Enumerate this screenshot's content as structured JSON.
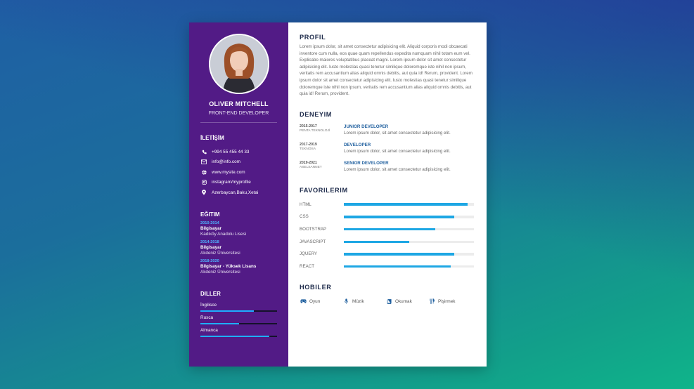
{
  "profile": {
    "name": "OLIVER MITCHELL",
    "role": "FRONT-END DEVELOPER"
  },
  "contact": {
    "heading": "İLETİŞİM",
    "items": [
      {
        "icon": "phone-icon",
        "text": "+994 55 455 44 33"
      },
      {
        "icon": "mail-icon",
        "text": "info@info.com"
      },
      {
        "icon": "globe-icon",
        "text": "www.mysite.com"
      },
      {
        "icon": "instagram-icon",
        "text": "instagram/myprofile"
      },
      {
        "icon": "location-icon",
        "text": "Azerbaycan,Baku,Xetai"
      }
    ]
  },
  "education": {
    "heading": "EĞITIM",
    "items": [
      {
        "years": "2010-2014",
        "degree": "Bilgisayar",
        "school": "Kadıköy Anadolu Lisesi"
      },
      {
        "years": "2014-2018",
        "degree": "Bilgisayar",
        "school": "Akdeniz Üniversitesi"
      },
      {
        "years": "2018-2020",
        "degree": "Bilgisayar - Yüksek Lisans",
        "school": "Akdeniz Üniversitesi"
      }
    ]
  },
  "languages": {
    "heading": "DILLER",
    "items": [
      {
        "name": "İngilisce",
        "level": 0.7
      },
      {
        "name": "Rusca",
        "level": 0.5
      },
      {
        "name": "Almanca",
        "level": 0.9
      }
    ]
  },
  "profil": {
    "heading": "PROFIL",
    "text": "Lorem ipsum dolor, sit amet consectetur adipisicing elit. Aliquid corporis modi obcaecati inventore cum nulla, eos quae quam repellendus expedita numquam nihil totam eum vel. Explicabo maiores voluptatibus placeat magni. Lorem ipsum dolor sit amet consectetur adipisicing elit. Iusto molestias quasi tenetur similique doloremque iste nihil non ipsum, veritatis rem accusantium alias aliquid omnis debitis, aut quia id! Rerum, provident. Lorem ipsum dolor sit amet consectetur adipisicing elit. Iusto molestias quasi tenetur similique doloremque iste nihil non ipsum, veritatis rem accusantium alias aliquid omnis debitis, aut quia id! Rerum, provident."
  },
  "experience": {
    "heading": "DENEYIM",
    "items": [
      {
        "years": "2015-2017",
        "company": "PENTA TEKNOLOJİ",
        "title": "JUNIOR DEVELOPER",
        "desc": "Lorem ipsum dolor, sit amet consectetur adipisicing elit."
      },
      {
        "years": "2017-2019",
        "company": "TEKNOSA",
        "title": "DEVELOPER",
        "desc": "Lorem ipsum dolor, sit amet consectetur adipisicing elit."
      },
      {
        "years": "2019-2021",
        "company": "ASELSANNET",
        "title": "SENIOR DEVELOPER",
        "desc": "Lorem ipsum dolor, sit amet consectetur adipisicing elit."
      }
    ]
  },
  "skills": {
    "heading": "FAVORILERIM",
    "items": [
      {
        "name": "HTML",
        "level": 0.95
      },
      {
        "name": "CSS",
        "level": 0.85
      },
      {
        "name": "BOOTSTRAP",
        "level": 0.7
      },
      {
        "name": "JAVASCRIPT",
        "level": 0.5
      },
      {
        "name": "JQUERY",
        "level": 0.85
      },
      {
        "name": "REACT",
        "level": 0.82
      }
    ]
  },
  "hobbies": {
    "heading": "HOBILER",
    "items": [
      {
        "icon": "gamepad-icon",
        "text": "Oyun"
      },
      {
        "icon": "microphone-icon",
        "text": "Müzik"
      },
      {
        "icon": "book-icon",
        "text": "Okumak"
      },
      {
        "icon": "utensils-icon",
        "text": "Pişirmek"
      }
    ]
  },
  "colors": {
    "sidebar": "#521b86",
    "accent": "#1ea7e4",
    "heading": "#1d2a4a"
  }
}
